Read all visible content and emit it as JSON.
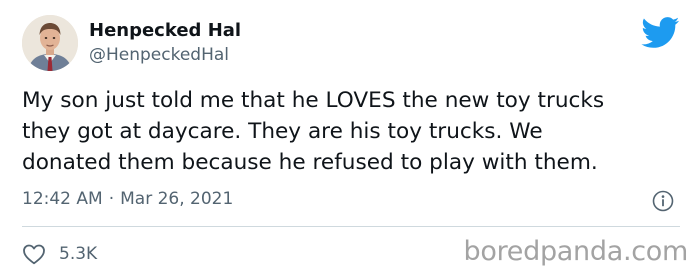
{
  "author": {
    "name": "Henpecked Hal",
    "handle": "@HenpeckedHal"
  },
  "tweet": {
    "lines": [
      "My son just told me that he LOVES the new toy trucks",
      "they got at daycare. They are his toy trucks. We",
      "donated them because he refused to play with them."
    ],
    "time": "12:42 AM",
    "separator": "·",
    "date": "Mar 26, 2021",
    "likes": "5.3K"
  },
  "icons": {
    "logo": "twitter-bird-icon",
    "info": "info-icon",
    "like": "heart-icon"
  },
  "colors": {
    "twitter_blue": "#1d9bf0",
    "text": "#0f1419",
    "secondary_text": "#536471",
    "divider": "#cfd9de",
    "watermark": "#a3a3a3"
  },
  "watermark": "boredpanda.com"
}
